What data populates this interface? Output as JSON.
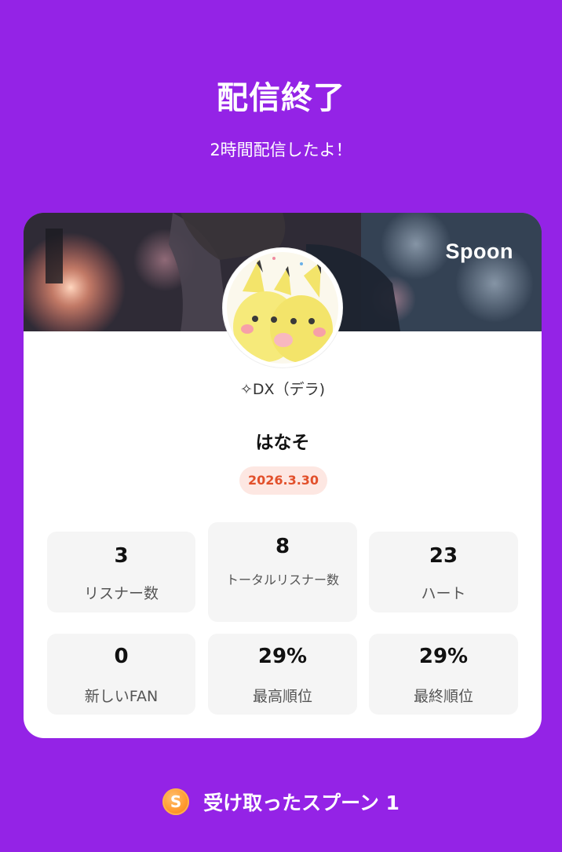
{
  "header": {
    "title": "配信終了",
    "subtitle": "2時間配信したよ！"
  },
  "card": {
    "brand": "Spoon",
    "channel_name": "✧DX（デラ)",
    "live_title": "はなそ",
    "date": "2026.3.30",
    "stats": [
      {
        "value": "3",
        "label": "リスナー数"
      },
      {
        "value": "8",
        "label": "トータルリスナー数"
      },
      {
        "value": "23",
        "label": "ハート"
      },
      {
        "value": "0",
        "label": "新しいFAN"
      },
      {
        "value": "29%",
        "label": "最高順位"
      },
      {
        "value": "29%",
        "label": "最終順位"
      }
    ]
  },
  "footer": {
    "coin_symbol": "S",
    "spoon_text": "受け取ったスプーン 1"
  },
  "colors": {
    "background": "#9423e6",
    "card": "#ffffff",
    "stat_tile": "#f5f5f5",
    "date_badge_bg": "#fde7e2",
    "date_badge_text": "#e2502b",
    "coin": "#ff9a2e"
  }
}
